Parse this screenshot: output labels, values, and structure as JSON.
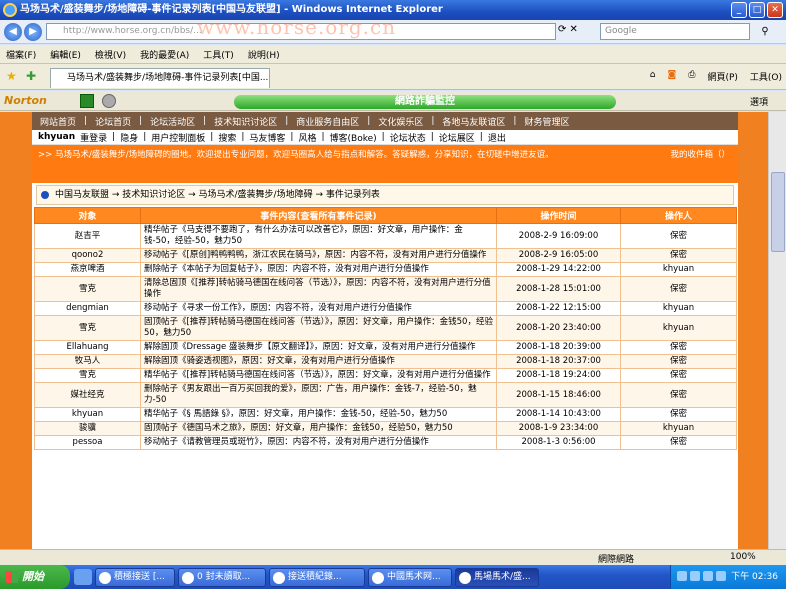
{
  "window": {
    "title": "马场马术/盛装舞步/场地障碍-事件记录列表[中国马友联盟] - Windows Internet Explorer"
  },
  "address": {
    "url": "http://www.horse.org.cn/bbs/...",
    "watermark": "www.horse.org.cn"
  },
  "search": {
    "placeholder": "Google"
  },
  "menu": [
    "檔案(F)",
    "編輯(E)",
    "檢視(V)",
    "我的最愛(A)",
    "工具(T)",
    "說明(H)"
  ],
  "tab": {
    "label": "马场马术/盛装舞步/场地障碍-事件记录列表[中国..."
  },
  "tools": {
    "page": "網頁(P)",
    "tools": "工具(O)"
  },
  "norton": {
    "brand": "Norton",
    "pill": "網路詐騙監控",
    "options": "選項"
  },
  "site": {
    "topnav": [
      "网站首页",
      "论坛首页",
      "论坛活动区",
      "技术知识讨论区",
      "商业服务自由区",
      "文化娱乐区",
      "各地马友联谊区",
      "财务管理区"
    ],
    "user": "khyuan",
    "usernav": [
      "重登录",
      "隐身",
      "用户控制面板",
      "搜索",
      "马友博客",
      "风格",
      "博客(Boke)",
      "论坛状态",
      "论坛展区",
      "退出"
    ],
    "welcome": ">> 马场马术/盛装舞步/场地障碍的圈地。欢迎提出专业问题，欢迎马圈高人给与指点和解答。答疑解惑，分享知识，在切磋中增进友谊。",
    "inbox": "我的收件箱（）",
    "breadcrumb": "中国马友联盟 → 技术知识讨论区 → 马场马术/盛装舞步/场地障碍 → 事件记录列表"
  },
  "table": {
    "headers": [
      "对象",
      "事件内容(查看所有事件记录)",
      "操作时间",
      "操作人"
    ],
    "rows": [
      {
        "obj": "赵吉平",
        "content": "精华帖子《马支得不要跑了，有什么办法可以改善它》，原因：好文章，用户操作：金钱-50，经验-50，魅力50",
        "time": "2008-2-9 16:09:00",
        "op": "保密"
      },
      {
        "obj": "qoono2",
        "content": "移动帖子《[原创]鸭鸭鸭鸭，浙江农民在骑马》，原因：内容不符，没有对用户进行分值操作",
        "time": "2008-2-9 16:05:00",
        "op": "保密"
      },
      {
        "obj": "燕京啤酒",
        "content": "删除帖子《本帖子为回复帖子》，原因：内容不符，没有对用户进行分值操作",
        "time": "2008-1-29 14:22:00",
        "op": "khyuan"
      },
      {
        "obj": "雪克",
        "content": "清除总固顶《[推荐]转帖骑马德国在线问答（节选）》，原因：内容不符，没有对用户进行分值操作",
        "time": "2008-1-28 15:01:00",
        "op": "保密"
      },
      {
        "obj": "dengmian",
        "content": "移动帖子《寻求一份工作》，原因：内容不符，没有对用户进行分值操作",
        "time": "2008-1-22 12:15:00",
        "op": "khyuan"
      },
      {
        "obj": "雪克",
        "content": "固顶帖子《[推荐]转帖骑马德国在线问答（节选）》，原因：好文章，用户操作：金钱50，经验50，魅力50",
        "time": "2008-1-20 23:40:00",
        "op": "khyuan"
      },
      {
        "obj": "Ellahuang",
        "content": "解除固顶《Dressage 盛装舞步【原文翻译】》，原因：好文章，没有对用户进行分值操作",
        "time": "2008-1-18 20:39:00",
        "op": "保密"
      },
      {
        "obj": "牧马人",
        "content": "解除固顶《骑姿透视图》，原因：好文章，没有对用户进行分值操作",
        "time": "2008-1-18 20:37:00",
        "op": "保密"
      },
      {
        "obj": "雪克",
        "content": "精华帖子《[推荐]转帖骑马德国在线问答（节选）》，原因：好文章，没有对用户进行分值操作",
        "time": "2008-1-18 19:24:00",
        "op": "保密"
      },
      {
        "obj": "媒社经克",
        "content": "删除帖子《男友跟出一百万买回我的爱》，原因：广告，用户操作：金钱-7，经验-50，魅力-50",
        "time": "2008-1-15 18:46:00",
        "op": "保密"
      },
      {
        "obj": "khyuan",
        "content": "精华帖子《§ 馬語錄 §》，原因：好文章，用户操作：金钱-50，经验-50，魅力50",
        "time": "2008-1-14 10:43:00",
        "op": "保密"
      },
      {
        "obj": "骏骥",
        "content": "固顶帖子《德国马术之旅》，原因：好文章，用户操作：金钱50，经验50，魅力50",
        "time": "2008-1-9 23:34:00",
        "op": "khyuan"
      },
      {
        "obj": "pessoa",
        "content": "移动帖子《请教管理员或斑竹》，原因：内容不符，没有对用户进行分值操作",
        "time": "2008-1-3 0:56:00",
        "op": "保密"
      }
    ]
  },
  "status": {
    "zone": "網際網路",
    "zoom": "100%"
  },
  "taskbar": {
    "start": "開始",
    "tasks": [
      "積極接送 [...",
      "0 封未讀取...",
      "接送積紀錄...",
      "中國馬术网...",
      "馬場馬术/盛..."
    ],
    "clock": "下午 02:36"
  }
}
